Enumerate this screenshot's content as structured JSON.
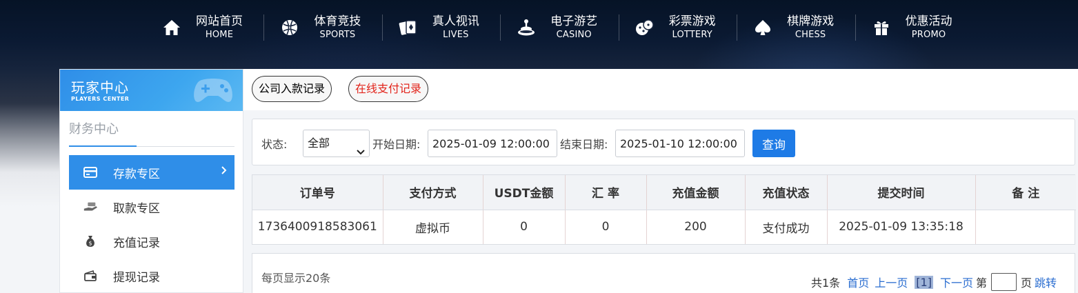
{
  "nav": [
    {
      "cn": "网站首页",
      "en": "HOME",
      "icon": "home-icon"
    },
    {
      "cn": "体育竞技",
      "en": "SPORTS",
      "icon": "ball-icon"
    },
    {
      "cn": "真人视讯",
      "en": "LIVES",
      "icon": "cards-icon"
    },
    {
      "cn": "电子游艺",
      "en": "CASINO",
      "icon": "slot-icon"
    },
    {
      "cn": "彩票游戏",
      "en": "LOTTERY",
      "icon": "dice-icon"
    },
    {
      "cn": "棋牌游戏",
      "en": "CHESS",
      "icon": "spade-icon"
    },
    {
      "cn": "优惠活动",
      "en": "PROMO",
      "icon": "gift-icon"
    }
  ],
  "sidebar": {
    "banner_cn": "玩家中心",
    "banner_en": "PLAYERS CENTER",
    "section_title": "财务中心",
    "items": [
      {
        "label": "存款专区",
        "icon": "card-icon",
        "active": true
      },
      {
        "label": "取款专区",
        "icon": "cash-hand-icon",
        "active": false
      },
      {
        "label": "充值记录",
        "icon": "money-bag-icon",
        "active": false
      },
      {
        "label": "提现记录",
        "icon": "wallet-icon",
        "active": false
      }
    ]
  },
  "tabs": [
    {
      "label": "公司入款记录"
    },
    {
      "label": "在线支付记录"
    }
  ],
  "filter": {
    "status_label": "状态:",
    "status_value": "全部",
    "start_label": "开始日期:",
    "start_value": "2025-01-09 12:00:00",
    "end_label": "结束日期:",
    "end_value": "2025-01-10 12:00:00",
    "query_label": "查询"
  },
  "table": {
    "headers": [
      "订单号",
      "支付方式",
      "USDT金额",
      "汇 率",
      "充值金额",
      "充值状态",
      "提交时间",
      "备 注"
    ],
    "rows": [
      [
        "1736400918583061",
        "虚拟币",
        "0",
        "0",
        "200",
        "支付成功",
        "2025-01-09 13:35:18",
        ""
      ]
    ]
  },
  "footer": {
    "per_page": "每页显示20条",
    "total": "共1条",
    "first": "首页",
    "prev": "上一页",
    "current": "[1]",
    "next": "下一页",
    "page_prefix": "第",
    "page_suffix": "页",
    "jump": "跳转"
  },
  "colors": {
    "accent": "#2f8ee8",
    "button": "#1e7be6",
    "active_tab_text": "#e2231a",
    "link": "#2a6dd0"
  }
}
